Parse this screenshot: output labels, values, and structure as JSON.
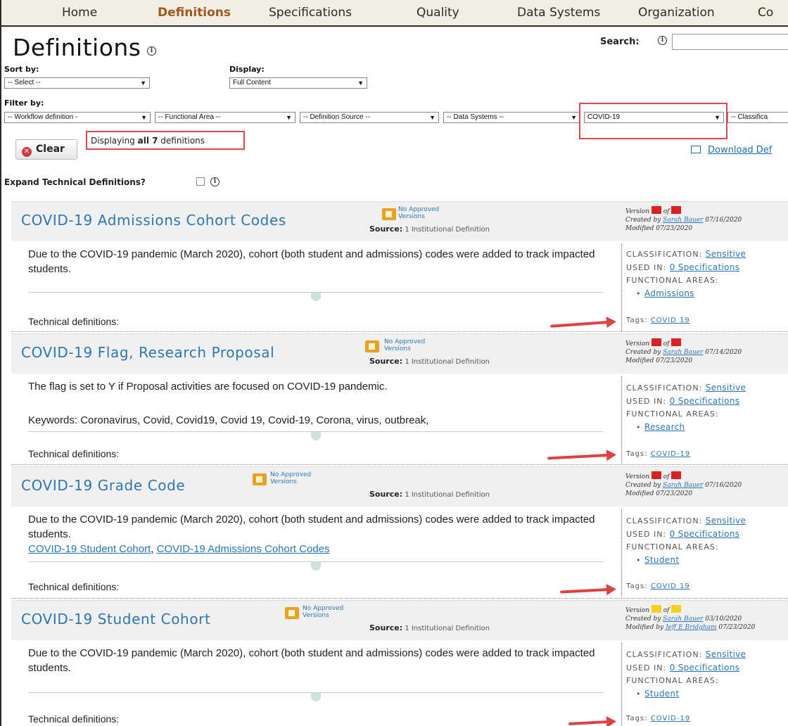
{
  "nav": {
    "items": [
      "Home",
      "Definitions",
      "Specifications",
      "Quality",
      "Data Systems",
      "Organization",
      "Co"
    ],
    "active": "Definitions"
  },
  "header": {
    "title": "Definitions",
    "search_label": "Search:"
  },
  "controls": {
    "sort_label": "Sort by:",
    "sort_value": "-- Select --",
    "display_label": "Display:",
    "display_value": "Full Content",
    "filter_label": "Filter by:",
    "filters": [
      "-- Workflow definition -",
      "-- Functional Area --",
      "-- Definition Source --",
      "-- Data Systems --",
      "COVID-19",
      "-- Classifica"
    ],
    "clear_label": "Clear",
    "displaying_prefix": "Displaying ",
    "displaying_bold": "all 7",
    "displaying_suffix": " definitions",
    "download_label": "Download Def",
    "expand_label": "Expand Technical Definitions?"
  },
  "colors": {
    "accent": "#2d76b6",
    "nav_active": "#a0561c",
    "version_red": "#e02020",
    "version_yellow": "#f4d21a",
    "annotation_red": "#e0474c"
  },
  "definitions": [
    {
      "title": "COVID-19 Admissions Cohort Codes",
      "badge_line1": "No Approved",
      "badge_line2": "Versions",
      "source_label": "Source:",
      "source_value": "1 Institutional Definition",
      "version_label": "Version",
      "version_of": "of",
      "created_prefix": "Created by ",
      "created_by": "Sarah Bauer",
      "created_date": " 07/16/2020",
      "modified": "Modified 07/23/2020",
      "description": "Due to the COVID-19 pandemic (March 2020), cohort (both student and admissions) codes were added to track impacted students.",
      "classification_label": "Classification:",
      "classification": "Sensitive",
      "used_in_label": "Used in:",
      "used_in": "0 Specifications",
      "functional_areas_label": "Functional Areas:",
      "functional_area": "Admissions",
      "technical_label": "Technical definitions:",
      "tags_label": "Tags:",
      "tag": "COVID 19"
    },
    {
      "title": "COVID-19 Flag, Research Proposal",
      "badge_line1": "No Approved",
      "badge_line2": "Versions",
      "source_label": "Source:",
      "source_value": "1 Institutional Definition",
      "version_label": "Version",
      "version_of": "of",
      "created_prefix": "Created by ",
      "created_by": "Sarah Bauer",
      "created_date": " 07/14/2020",
      "modified": "Modified 07/23/2020",
      "description": "The flag is set to Y if Proposal activities are focused on COVID-19 pandemic.",
      "keywords": "Keywords: Coronavirus, Covid, Covid19, Covid 19, Covid-19, Corona, virus, outbreak,",
      "classification_label": "Classification:",
      "classification": "Sensitive",
      "used_in_label": "Used in:",
      "used_in": "0 Specifications",
      "functional_areas_label": "Functional Areas:",
      "functional_area": "Research",
      "technical_label": "Technical definitions:",
      "tags_label": "Tags:",
      "tag": "COVID-19"
    },
    {
      "title": "COVID-19 Grade Code",
      "badge_line1": "No Approved",
      "badge_line2": "Versions",
      "source_label": "Source:",
      "source_value": "1 Institutional Definition",
      "version_label": "Version",
      "version_of": "of",
      "created_prefix": "Created by ",
      "created_by": "Sarah Bauer",
      "created_date": " 07/16/2020",
      "modified": "Modified 07/23/2020",
      "description": "Due to the COVID-19 pandemic (March 2020), cohort (both student and admissions) codes were added to track impacted students.",
      "link1": "COVID-19 Student Cohort",
      "link_sep": ", ",
      "link2": "COVID-19 Admissions Cohort Codes",
      "classification_label": "Classification:",
      "classification": "Sensitive",
      "used_in_label": "Used in:",
      "used_in": "0 Specifications",
      "functional_areas_label": "Functional Areas:",
      "functional_area": "Student",
      "technical_label": "Technical definitions:",
      "tags_label": "Tags:",
      "tag": "COVID 19"
    },
    {
      "title": "COVID-19 Student Cohort",
      "badge_line1": "No Approved",
      "badge_line2": "Versions",
      "source_label": "Source:",
      "source_value": "1 Institutional Definition",
      "version_label": "Version",
      "version_of": "of",
      "created_prefix": "Created by ",
      "created_by": "Sarah Bauer",
      "created_date": " 03/10/2020",
      "modified_prefix": "Modified by ",
      "modified_by": "Jeff E Bridgham",
      "modified_date": " 07/23/2020",
      "description": "Due to the COVID-19 pandemic (March 2020), cohort (both student and admissions) codes were added to track impacted students.",
      "classification_label": "Classification:",
      "classification": "Sensitive",
      "used_in_label": "Used in:",
      "used_in": "0 Specifications",
      "functional_areas_label": "Functional Areas:",
      "functional_area": "Student",
      "technical_label": "Technical definitions:",
      "tags_label": "Tags:",
      "tag": "COVID-19"
    }
  ]
}
